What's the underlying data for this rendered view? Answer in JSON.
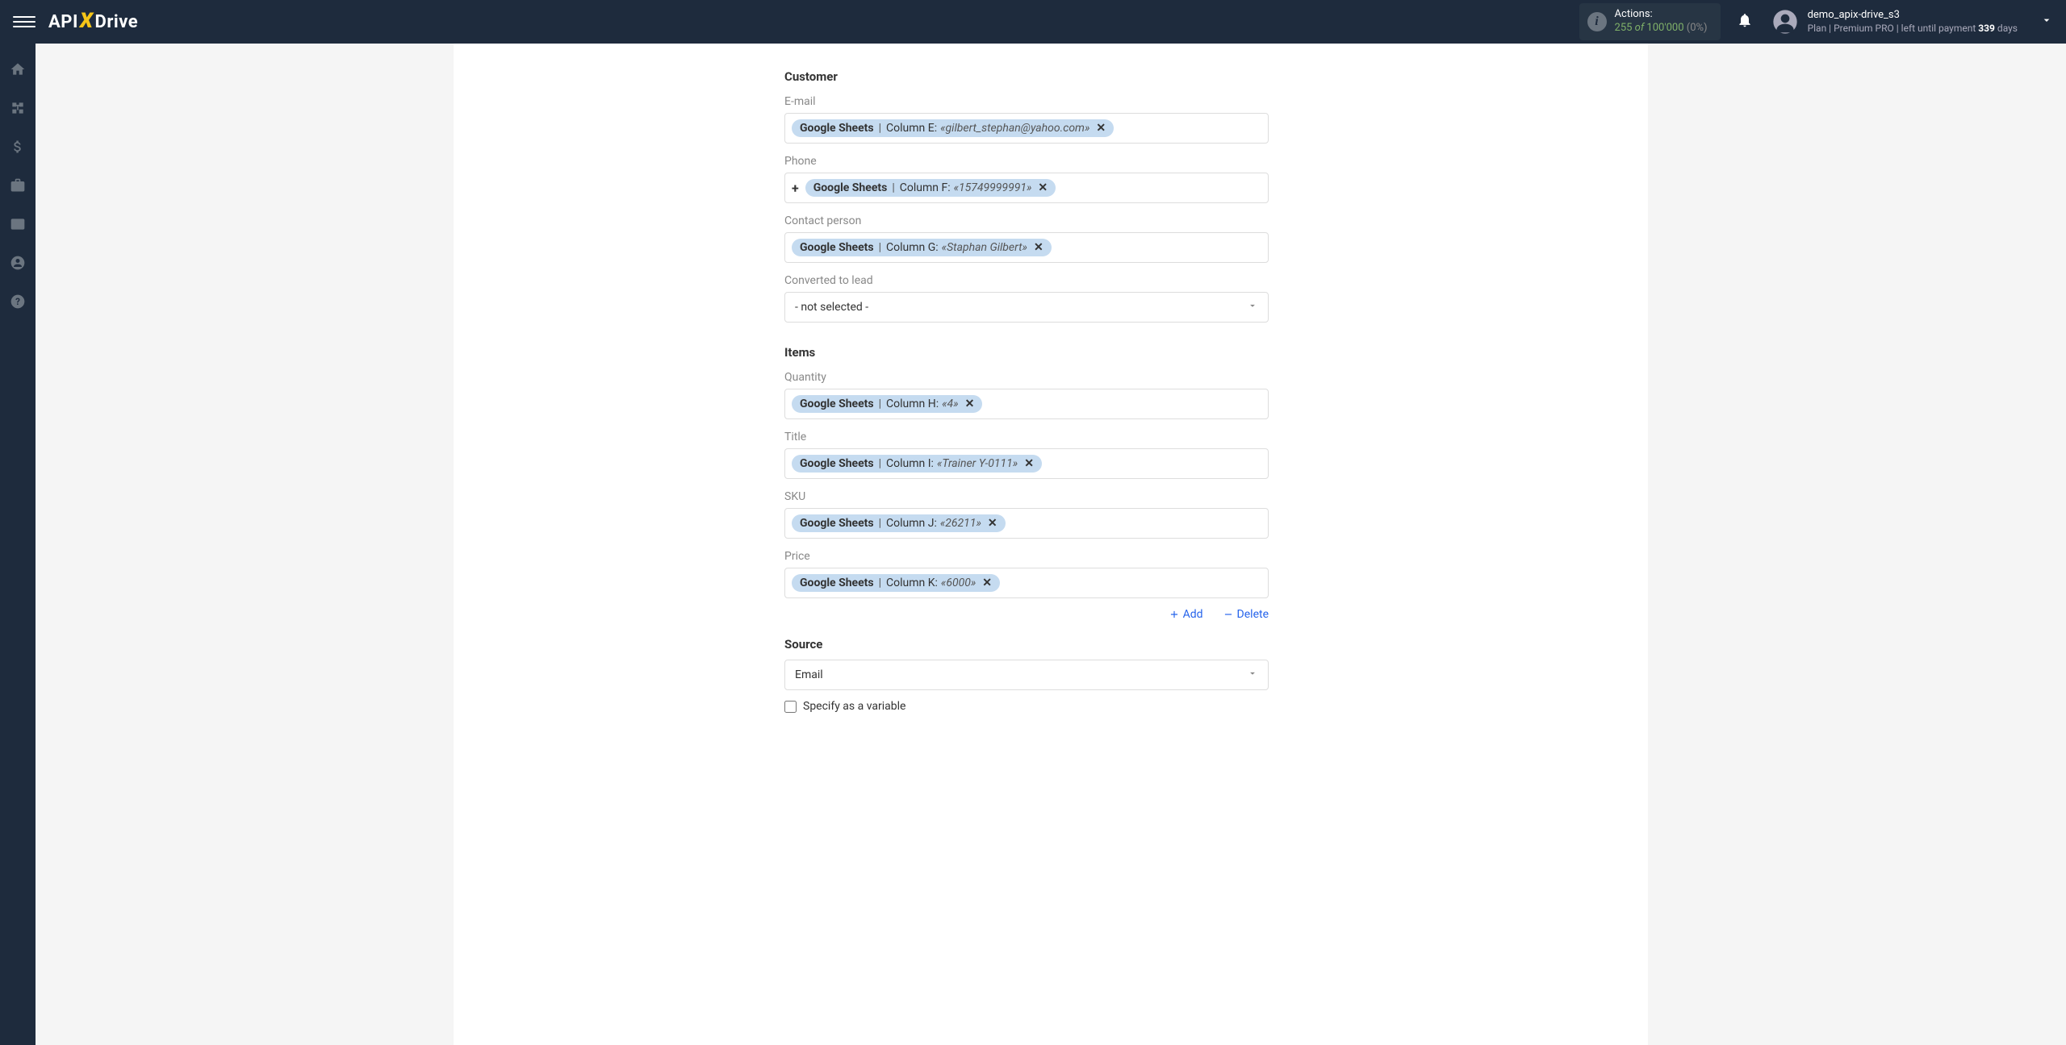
{
  "header": {
    "logo_part1": "API",
    "logo_x": "X",
    "logo_part2": "Drive",
    "actions_label": "Actions:",
    "actions_count": "255",
    "actions_of": " of ",
    "actions_total": "100'000",
    "actions_pct": " (0%)",
    "user_name": "demo_apix-drive_s3",
    "plan_prefix": "Plan |",
    "plan_name": "Premium PRO",
    "plan_mid": "| left until payment ",
    "plan_days": "339",
    "plan_suffix": " days"
  },
  "sections": {
    "customer": {
      "title": "Customer",
      "email_label": "E-mail",
      "email_token": {
        "src": "Google Sheets",
        "col": "Column E:",
        "val": "«gilbert_stephan@yahoo.com»"
      },
      "phone_label": "Phone",
      "phone_prefix": "+",
      "phone_token": {
        "src": "Google Sheets",
        "col": "Column F:",
        "val": "«15749999991»"
      },
      "contact_label": "Contact person",
      "contact_token": {
        "src": "Google Sheets",
        "col": "Column G:",
        "val": "«Staphan Gilbert»"
      },
      "converted_label": "Converted to lead",
      "converted_value": "- not selected -"
    },
    "items": {
      "title": "Items",
      "qty_label": "Quantity",
      "qty_token": {
        "src": "Google Sheets",
        "col": "Column H:",
        "val": "«4»"
      },
      "title_label": "Title",
      "title_token": {
        "src": "Google Sheets",
        "col": "Column I:",
        "val": "«Trainer Y-0111»"
      },
      "sku_label": "SKU",
      "sku_token": {
        "src": "Google Sheets",
        "col": "Column J:",
        "val": "«26211»"
      },
      "price_label": "Price",
      "price_token": {
        "src": "Google Sheets",
        "col": "Column K:",
        "val": "«6000»"
      },
      "add_label": "Add",
      "delete_label": "Delete"
    },
    "source": {
      "title": "Source",
      "value": "Email",
      "checkbox_label": "Specify as a variable"
    }
  }
}
